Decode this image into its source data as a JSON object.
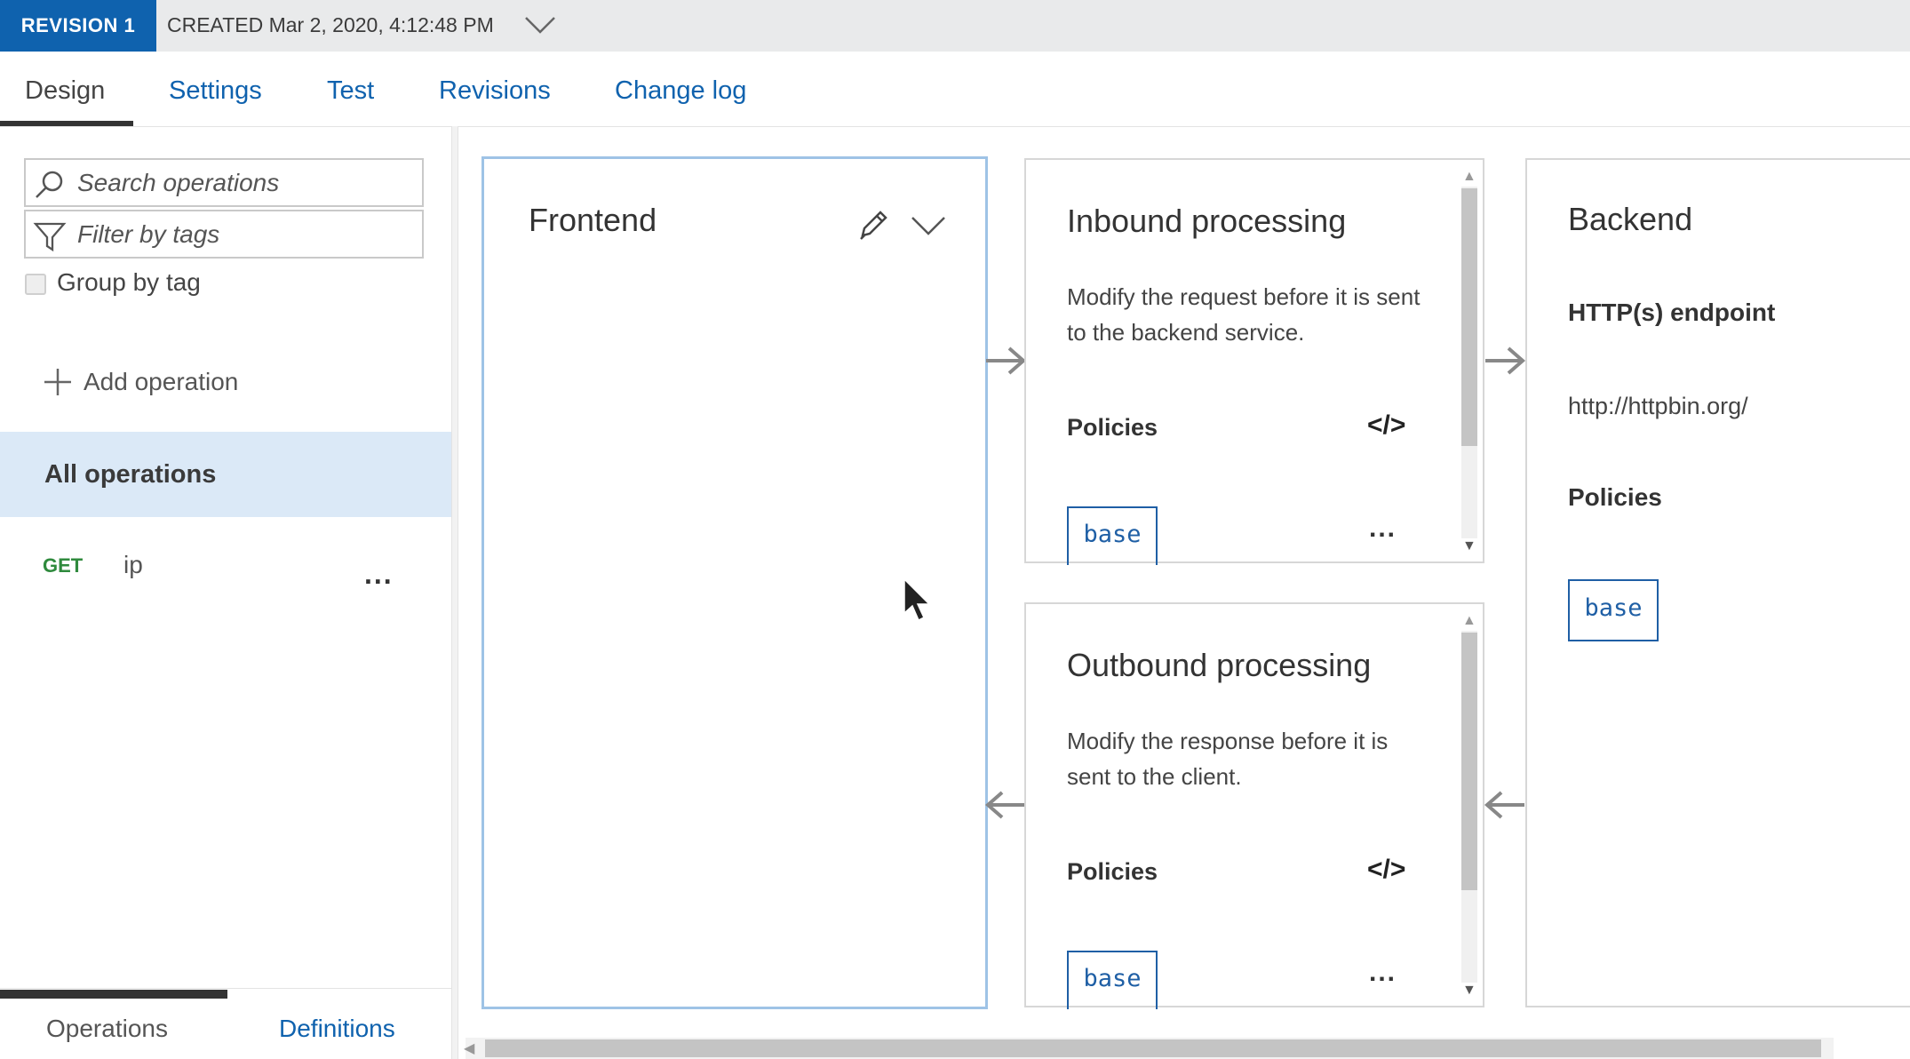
{
  "revision_bar": {
    "badge": "REVISION 1",
    "created": "CREATED Mar 2, 2020, 4:12:48 PM"
  },
  "tabs": [
    {
      "label": "Design",
      "active": true
    },
    {
      "label": "Settings",
      "active": false
    },
    {
      "label": "Test",
      "active": false
    },
    {
      "label": "Revisions",
      "active": false
    },
    {
      "label": "Change log",
      "active": false
    }
  ],
  "sidebar": {
    "search_placeholder": "Search operations",
    "filter_placeholder": "Filter by tags",
    "group_by_tag_label": "Group by tag",
    "add_operation_label": "Add operation",
    "all_operations_label": "All operations",
    "operations": [
      {
        "method": "GET",
        "name": "ip",
        "more": "..."
      }
    ],
    "bottom_tabs": [
      {
        "label": "Operations",
        "active": true
      },
      {
        "label": "Definitions",
        "active": false
      }
    ]
  },
  "frontend": {
    "title": "Frontend",
    "icons": [
      "pencil-icon",
      "chevron-down-icon"
    ]
  },
  "inbound": {
    "title": "Inbound processing",
    "description": "Modify the request before it is sent to the backend service.",
    "policies_label": "Policies",
    "code_icon": "</>",
    "policy_chip": "base",
    "more": "..."
  },
  "outbound": {
    "title": "Outbound processing",
    "description": "Modify the response before it is sent to the client.",
    "policies_label": "Policies",
    "code_icon": "</>",
    "policy_chip": "base",
    "more": "..."
  },
  "backend": {
    "title": "Backend",
    "endpoint_label": "HTTP(s) endpoint",
    "endpoint_url": "http://httpbin.org/",
    "policies_label": "Policies",
    "policy_chip": "base"
  },
  "colors": {
    "accent": "#0f62ae",
    "selected_row": "#dbe9f7",
    "get_method": "#2f8a3d",
    "frontend_border": "#9ec3e6"
  }
}
